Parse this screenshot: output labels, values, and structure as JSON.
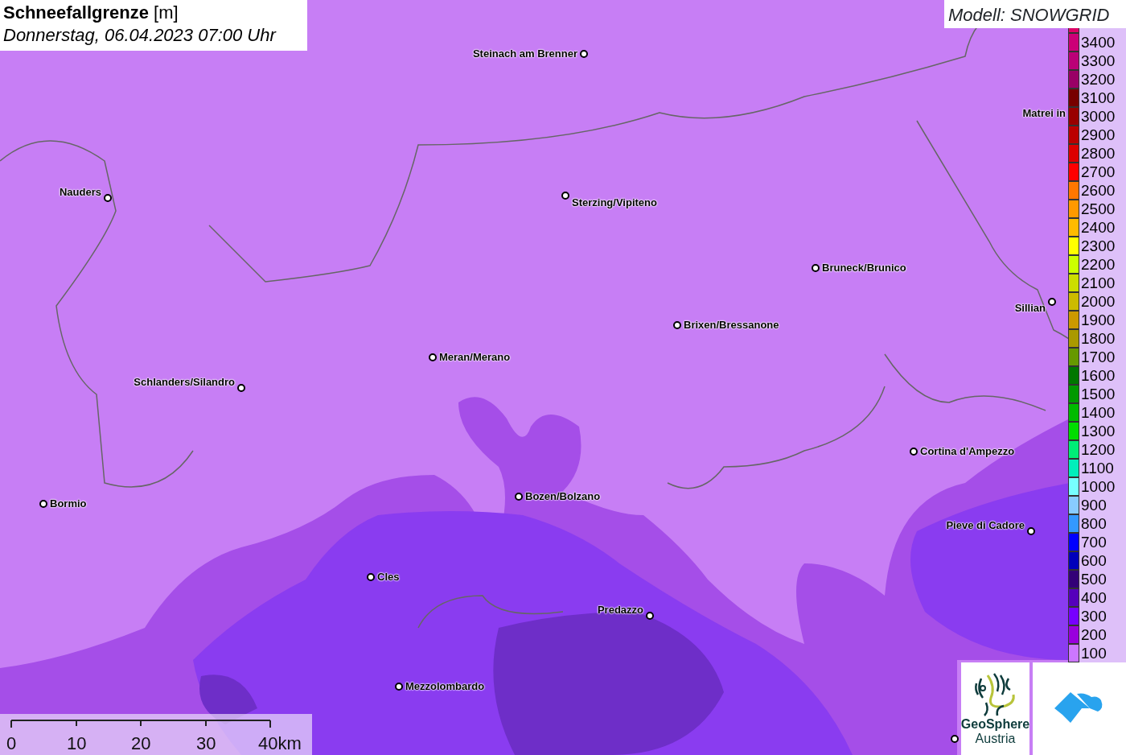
{
  "title": {
    "parameter": "Schneefallgrenze",
    "unit": "[m]",
    "datetime": "Donnerstag, 06.04.2023 07:00 Uhr"
  },
  "model": "Modell: SNOWGRID",
  "cities": [
    {
      "name": "Steinach am Brenner"
    },
    {
      "name": "Nauders"
    },
    {
      "name": "Sterzing/Vipiteno"
    },
    {
      "name": "Matrei in"
    },
    {
      "name": "Bruneck/Brunico"
    },
    {
      "name": "Sillian"
    },
    {
      "name": "Brixen/Bressanone"
    },
    {
      "name": "Meran/Merano"
    },
    {
      "name": "Schlanders/Silandro"
    },
    {
      "name": "Cortina d'Ampezzo"
    },
    {
      "name": "Bormio"
    },
    {
      "name": "Bozen/Bolzano"
    },
    {
      "name": "Pieve di Cadore"
    },
    {
      "name": "Cles"
    },
    {
      "name": "Predazzo"
    },
    {
      "name": "Mezzolombardo"
    }
  ],
  "legend": [
    {
      "label": "3400",
      "color": "#cc0077"
    },
    {
      "label": "3300",
      "color": "#bb0077"
    },
    {
      "label": "3200",
      "color": "#990066"
    },
    {
      "label": "3100",
      "color": "#770000"
    },
    {
      "label": "3000",
      "color": "#990000"
    },
    {
      "label": "2900",
      "color": "#bb0000"
    },
    {
      "label": "2800",
      "color": "#dd0000"
    },
    {
      "label": "2700",
      "color": "#ff0000"
    },
    {
      "label": "2600",
      "color": "#ff7700"
    },
    {
      "label": "2500",
      "color": "#ff9900"
    },
    {
      "label": "2400",
      "color": "#ffbb00"
    },
    {
      "label": "2300",
      "color": "#ffff00"
    },
    {
      "label": "2200",
      "color": "#ccff00"
    },
    {
      "label": "2100",
      "color": "#ccdd00"
    },
    {
      "label": "2000",
      "color": "#ccbb00"
    },
    {
      "label": "1900",
      "color": "#cc9900"
    },
    {
      "label": "1800",
      "color": "#aa9900"
    },
    {
      "label": "1700",
      "color": "#669900"
    },
    {
      "label": "1600",
      "color": "#007700"
    },
    {
      "label": "1500",
      "color": "#009900"
    },
    {
      "label": "1400",
      "color": "#00bb00"
    },
    {
      "label": "1300",
      "color": "#00dd00"
    },
    {
      "label": "1200",
      "color": "#00ee77"
    },
    {
      "label": "1100",
      "color": "#00eebb"
    },
    {
      "label": "1000",
      "color": "#77ffff"
    },
    {
      "label": "900",
      "color": "#88ccff"
    },
    {
      "label": "800",
      "color": "#3399ff"
    },
    {
      "label": "700",
      "color": "#0000ff"
    },
    {
      "label": "600",
      "color": "#0000bb"
    },
    {
      "label": "500",
      "color": "#330077"
    },
    {
      "label": "400",
      "color": "#5500bb"
    },
    {
      "label": "300",
      "color": "#7700ff"
    },
    {
      "label": "200",
      "color": "#9900dd"
    },
    {
      "label": "100",
      "color": "#cc77ff"
    }
  ],
  "scale": [
    "0",
    "10",
    "20",
    "30",
    "40km"
  ],
  "logo": {
    "line1": "GeoSphere",
    "line2": "Austria"
  }
}
